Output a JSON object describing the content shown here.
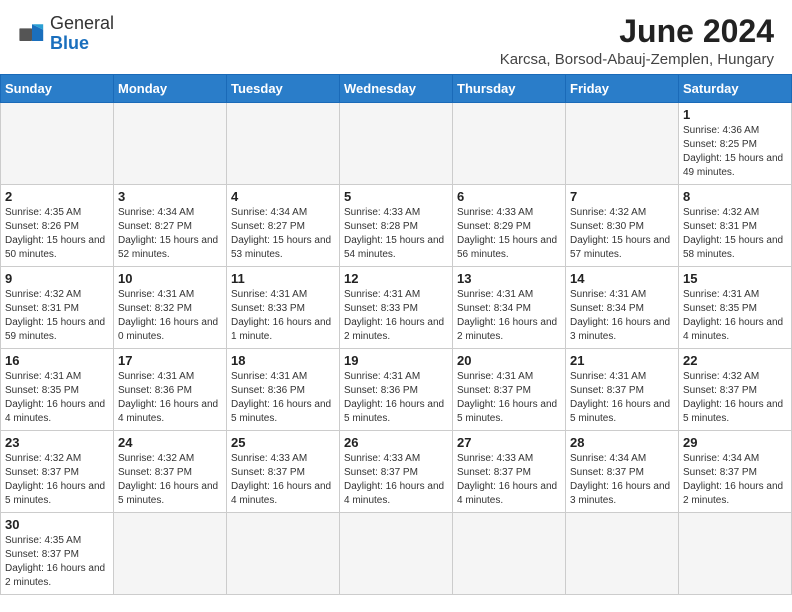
{
  "header": {
    "logo_general": "General",
    "logo_blue": "Blue",
    "title": "June 2024",
    "subtitle": "Karcsa, Borsod-Abauj-Zemplen, Hungary"
  },
  "weekdays": [
    "Sunday",
    "Monday",
    "Tuesday",
    "Wednesday",
    "Thursday",
    "Friday",
    "Saturday"
  ],
  "weeks": [
    [
      {
        "day": "",
        "info": ""
      },
      {
        "day": "",
        "info": ""
      },
      {
        "day": "",
        "info": ""
      },
      {
        "day": "",
        "info": ""
      },
      {
        "day": "",
        "info": ""
      },
      {
        "day": "",
        "info": ""
      },
      {
        "day": "1",
        "info": "Sunrise: 4:36 AM\nSunset: 8:25 PM\nDaylight: 15 hours\nand 49 minutes."
      }
    ],
    [
      {
        "day": "2",
        "info": "Sunrise: 4:35 AM\nSunset: 8:26 PM\nDaylight: 15 hours\nand 50 minutes."
      },
      {
        "day": "3",
        "info": "Sunrise: 4:34 AM\nSunset: 8:27 PM\nDaylight: 15 hours\nand 52 minutes."
      },
      {
        "day": "4",
        "info": "Sunrise: 4:34 AM\nSunset: 8:27 PM\nDaylight: 15 hours\nand 53 minutes."
      },
      {
        "day": "5",
        "info": "Sunrise: 4:33 AM\nSunset: 8:28 PM\nDaylight: 15 hours\nand 54 minutes."
      },
      {
        "day": "6",
        "info": "Sunrise: 4:33 AM\nSunset: 8:29 PM\nDaylight: 15 hours\nand 56 minutes."
      },
      {
        "day": "7",
        "info": "Sunrise: 4:32 AM\nSunset: 8:30 PM\nDaylight: 15 hours\nand 57 minutes."
      },
      {
        "day": "8",
        "info": "Sunrise: 4:32 AM\nSunset: 8:31 PM\nDaylight: 15 hours\nand 58 minutes."
      }
    ],
    [
      {
        "day": "9",
        "info": "Sunrise: 4:32 AM\nSunset: 8:31 PM\nDaylight: 15 hours\nand 59 minutes."
      },
      {
        "day": "10",
        "info": "Sunrise: 4:31 AM\nSunset: 8:32 PM\nDaylight: 16 hours\nand 0 minutes."
      },
      {
        "day": "11",
        "info": "Sunrise: 4:31 AM\nSunset: 8:33 PM\nDaylight: 16 hours\nand 1 minute."
      },
      {
        "day": "12",
        "info": "Sunrise: 4:31 AM\nSunset: 8:33 PM\nDaylight: 16 hours\nand 2 minutes."
      },
      {
        "day": "13",
        "info": "Sunrise: 4:31 AM\nSunset: 8:34 PM\nDaylight: 16 hours\nand 2 minutes."
      },
      {
        "day": "14",
        "info": "Sunrise: 4:31 AM\nSunset: 8:34 PM\nDaylight: 16 hours\nand 3 minutes."
      },
      {
        "day": "15",
        "info": "Sunrise: 4:31 AM\nSunset: 8:35 PM\nDaylight: 16 hours\nand 4 minutes."
      }
    ],
    [
      {
        "day": "16",
        "info": "Sunrise: 4:31 AM\nSunset: 8:35 PM\nDaylight: 16 hours\nand 4 minutes."
      },
      {
        "day": "17",
        "info": "Sunrise: 4:31 AM\nSunset: 8:36 PM\nDaylight: 16 hours\nand 4 minutes."
      },
      {
        "day": "18",
        "info": "Sunrise: 4:31 AM\nSunset: 8:36 PM\nDaylight: 16 hours\nand 5 minutes."
      },
      {
        "day": "19",
        "info": "Sunrise: 4:31 AM\nSunset: 8:36 PM\nDaylight: 16 hours\nand 5 minutes."
      },
      {
        "day": "20",
        "info": "Sunrise: 4:31 AM\nSunset: 8:37 PM\nDaylight: 16 hours\nand 5 minutes."
      },
      {
        "day": "21",
        "info": "Sunrise: 4:31 AM\nSunset: 8:37 PM\nDaylight: 16 hours\nand 5 minutes."
      },
      {
        "day": "22",
        "info": "Sunrise: 4:32 AM\nSunset: 8:37 PM\nDaylight: 16 hours\nand 5 minutes."
      }
    ],
    [
      {
        "day": "23",
        "info": "Sunrise: 4:32 AM\nSunset: 8:37 PM\nDaylight: 16 hours\nand 5 minutes."
      },
      {
        "day": "24",
        "info": "Sunrise: 4:32 AM\nSunset: 8:37 PM\nDaylight: 16 hours\nand 5 minutes."
      },
      {
        "day": "25",
        "info": "Sunrise: 4:33 AM\nSunset: 8:37 PM\nDaylight: 16 hours\nand 4 minutes."
      },
      {
        "day": "26",
        "info": "Sunrise: 4:33 AM\nSunset: 8:37 PM\nDaylight: 16 hours\nand 4 minutes."
      },
      {
        "day": "27",
        "info": "Sunrise: 4:33 AM\nSunset: 8:37 PM\nDaylight: 16 hours\nand 4 minutes."
      },
      {
        "day": "28",
        "info": "Sunrise: 4:34 AM\nSunset: 8:37 PM\nDaylight: 16 hours\nand 3 minutes."
      },
      {
        "day": "29",
        "info": "Sunrise: 4:34 AM\nSunset: 8:37 PM\nDaylight: 16 hours\nand 2 minutes."
      }
    ],
    [
      {
        "day": "30",
        "info": "Sunrise: 4:35 AM\nSunset: 8:37 PM\nDaylight: 16 hours\nand 2 minutes."
      },
      {
        "day": "",
        "info": ""
      },
      {
        "day": "",
        "info": ""
      },
      {
        "day": "",
        "info": ""
      },
      {
        "day": "",
        "info": ""
      },
      {
        "day": "",
        "info": ""
      },
      {
        "day": "",
        "info": ""
      }
    ]
  ]
}
